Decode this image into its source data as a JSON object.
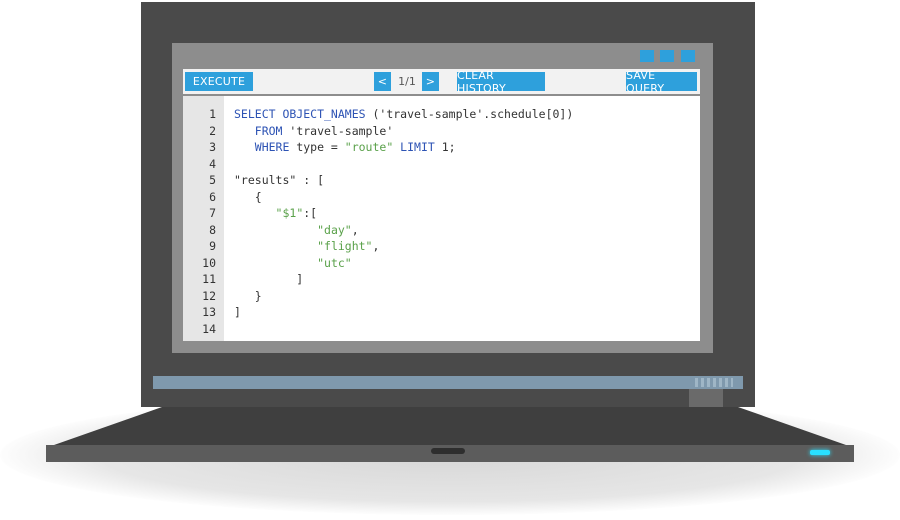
{
  "toolbar": {
    "execute_label": "EXECUTE",
    "prev_label": "<",
    "page_indicator": "1/1",
    "next_label": ">",
    "clear_history_label": "CLEAR HISTORY",
    "save_query_label": "SAVE QUERY"
  },
  "window_controls": [
    "minimize-button",
    "maximize-button",
    "close-button"
  ],
  "editor": {
    "line_numbers": [
      "1",
      "2",
      "3",
      "4",
      "5",
      "6",
      "7",
      "8",
      "9",
      "10",
      "11",
      "12",
      "13",
      "14"
    ],
    "lines": [
      [
        {
          "t": "SELECT OBJECT_NAMES ",
          "c": "kw"
        },
        {
          "t": "('travel-sample'.schedule[0])",
          "c": "txt"
        }
      ],
      [
        {
          "t": "   FROM ",
          "c": "kw"
        },
        {
          "t": "'travel-sample'",
          "c": "txt"
        }
      ],
      [
        {
          "t": "   WHERE ",
          "c": "kw"
        },
        {
          "t": "type = ",
          "c": "txt"
        },
        {
          "t": "\"route\"",
          "c": "str"
        },
        {
          "t": " LIMIT ",
          "c": "kw"
        },
        {
          "t": "1;",
          "c": "txt"
        }
      ],
      [],
      [
        {
          "t": "\"results\" : [",
          "c": "txt"
        }
      ],
      [
        {
          "t": "   {",
          "c": "txt"
        }
      ],
      [
        {
          "t": "      ",
          "c": "txt"
        },
        {
          "t": "\"$1\"",
          "c": "str"
        },
        {
          "t": ":[",
          "c": "txt"
        }
      ],
      [
        {
          "t": "            ",
          "c": "txt"
        },
        {
          "t": "\"day\"",
          "c": "str"
        },
        {
          "t": ",",
          "c": "txt"
        }
      ],
      [
        {
          "t": "            ",
          "c": "txt"
        },
        {
          "t": "\"flight\"",
          "c": "str"
        },
        {
          "t": ",",
          "c": "txt"
        }
      ],
      [
        {
          "t": "            ",
          "c": "txt"
        },
        {
          "t": "\"utc\"",
          "c": "str"
        }
      ],
      [
        {
          "t": "         ]",
          "c": "txt"
        }
      ],
      [
        {
          "t": "   }",
          "c": "txt"
        }
      ],
      [
        {
          "t": "]",
          "c": "txt"
        }
      ],
      []
    ]
  },
  "colors": {
    "accent": "#2ea0dc",
    "keyword": "#2d53b4",
    "string": "#5aa14a",
    "power_led": "#29e0ff"
  }
}
